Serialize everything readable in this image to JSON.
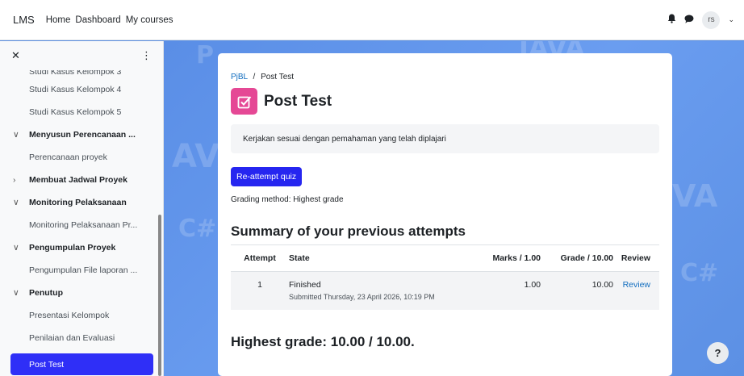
{
  "navbar": {
    "brand": "LMS",
    "links": [
      "Home",
      "Dashboard",
      "My courses"
    ],
    "avatar_initials": "rs",
    "icons": [
      "bell-icon",
      "chat-icon",
      "chevron-down-icon"
    ]
  },
  "sidebar": {
    "cut_item": "Studi Kasus Kelompok 3",
    "rows": [
      {
        "kind": "item",
        "label": "Studi Kasus Kelompok 4"
      },
      {
        "kind": "item",
        "label": "Studi Kasus Kelompok 5"
      },
      {
        "kind": "section",
        "label": "Menyusun Perencanaan ...",
        "expanded": true
      },
      {
        "kind": "item",
        "label": "Perencanaan proyek"
      },
      {
        "kind": "section",
        "label": "Membuat Jadwal Proyek",
        "expanded": false
      },
      {
        "kind": "section",
        "label": "Monitoring Pelaksanaan",
        "expanded": true
      },
      {
        "kind": "item",
        "label": "Monitoring Pelaksanaan Pr..."
      },
      {
        "kind": "section",
        "label": "Pengumpulan Proyek",
        "expanded": true
      },
      {
        "kind": "item",
        "label": "Pengumpulan File laporan ..."
      },
      {
        "kind": "section",
        "label": "Penutup",
        "expanded": true
      },
      {
        "kind": "item",
        "label": "Presentasi Kelompok"
      },
      {
        "kind": "item",
        "label": "Penilaian dan Evaluasi"
      }
    ],
    "active_item": "Post Test"
  },
  "main": {
    "breadcrumb": {
      "course": "PjBL",
      "separator": "/",
      "current": "Post Test"
    },
    "title": "Post Test",
    "description": "Kerjakan sesuai dengan pemahaman yang telah diplajari",
    "reattempt_label": "Re-attempt quiz",
    "grading_method": "Grading method: Highest grade",
    "summary_title": "Summary of your previous attempts",
    "table": {
      "headers": [
        "Attempt",
        "State",
        "Marks / 1.00",
        "Grade / 10.00",
        "Review"
      ],
      "rows": [
        {
          "attempt": "1",
          "state": "Finished",
          "submitted": "Submitted Thursday, 23 April 2026, 10:19 PM",
          "marks": "1.00",
          "grade": "10.00",
          "review": "Review"
        }
      ]
    },
    "highest_grade": "Highest grade: 10.00 / 10.00."
  },
  "help_label": "?",
  "colors": {
    "primary": "#2626f0",
    "quiz_icon": "#e54895",
    "link": "#0f6cbf",
    "background": "#5b8fe0"
  }
}
